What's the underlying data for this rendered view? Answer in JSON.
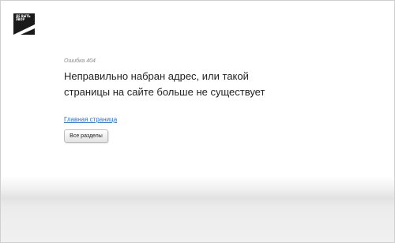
{
  "logo": {
    "text_lines": [
      "ДЕ ВЫТЬ",
      "ЭВОР"
    ],
    "icon": "brand-logo-icon"
  },
  "error": {
    "code_label": "Ошибка 404",
    "headline_line1": "Неправильно набран адрес, или такой",
    "headline_line2": "страницы на сайте больше не существует"
  },
  "links": {
    "home_label": "Главная страница"
  },
  "buttons": {
    "sections_label": "Все разделы"
  },
  "colors": {
    "link": "#2a6fc9",
    "text": "#222222",
    "muted": "#8a8a8a",
    "logo_bg": "#1a1a1a"
  }
}
